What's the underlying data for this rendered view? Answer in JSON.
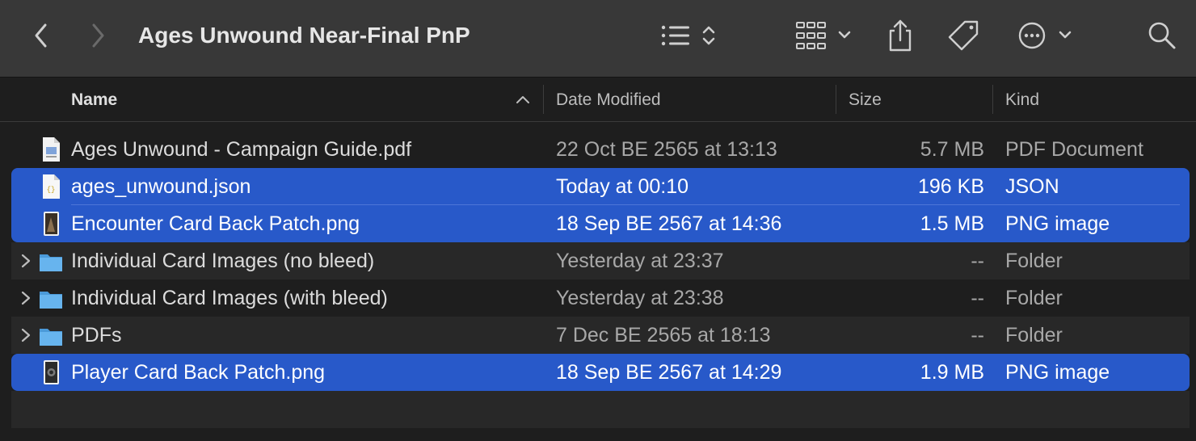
{
  "window": {
    "title": "Ages Unwound Near-Final PnP"
  },
  "toolbar": {
    "icons": [
      "chevron-left-icon",
      "chevron-right-icon",
      "list-view-icon",
      "icon-grid-icon",
      "share-icon",
      "tag-icon",
      "more-icon",
      "search-icon"
    ]
  },
  "columns": {
    "name": "Name",
    "date": "Date Modified",
    "size": "Size",
    "kind": "Kind"
  },
  "files": [
    {
      "name": "Ages Unwound - Campaign Guide.pdf",
      "date": "22 Oct BE 2565 at 13:13",
      "size": "5.7 MB",
      "kind": "PDF Document",
      "type": "pdf",
      "selected": false
    },
    {
      "name": "ages_unwound.json",
      "date": "Today at 00:10",
      "size": "196 KB",
      "kind": "JSON",
      "type": "json",
      "selected": true
    },
    {
      "name": "Encounter Card Back Patch.png",
      "date": "18 Sep BE 2567 at 14:36",
      "size": "1.5 MB",
      "kind": "PNG image",
      "type": "png",
      "selected": true
    },
    {
      "name": "Individual Card Images (no bleed)",
      "date": "Yesterday at 23:37",
      "size": "--",
      "kind": "Folder",
      "type": "folder",
      "selected": false
    },
    {
      "name": "Individual Card Images (with bleed)",
      "date": "Yesterday at 23:38",
      "size": "--",
      "kind": "Folder",
      "type": "folder",
      "selected": false
    },
    {
      "name": "PDFs",
      "date": "7 Dec BE 2565 at 18:13",
      "size": "--",
      "kind": "Folder",
      "type": "folder",
      "selected": false
    },
    {
      "name": "Player Card Back Patch.png",
      "date": "18 Sep BE 2567 at 14:29",
      "size": "1.9 MB",
      "kind": "PNG image",
      "type": "png",
      "selected": true
    }
  ],
  "colors": {
    "selection": "#2859c9",
    "folder": "#5aa9e6",
    "toolbar": "#383838",
    "background": "#1e1e1e"
  }
}
